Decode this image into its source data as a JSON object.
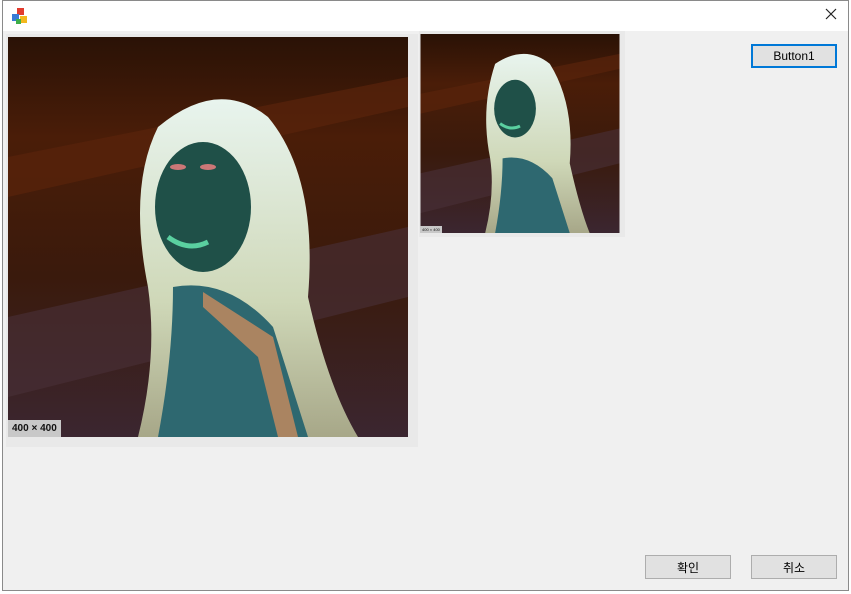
{
  "window": {
    "icon": "app-cubes-icon",
    "close_icon": "close-icon"
  },
  "images": {
    "large": {
      "size_label": "400 × 400"
    },
    "small": {
      "size_label": "400 × 400"
    }
  },
  "buttons": {
    "button1": "Button1",
    "ok": "확인",
    "cancel": "취소"
  },
  "colors": {
    "accent": "#0078d7",
    "background": "#f0f0f0"
  }
}
